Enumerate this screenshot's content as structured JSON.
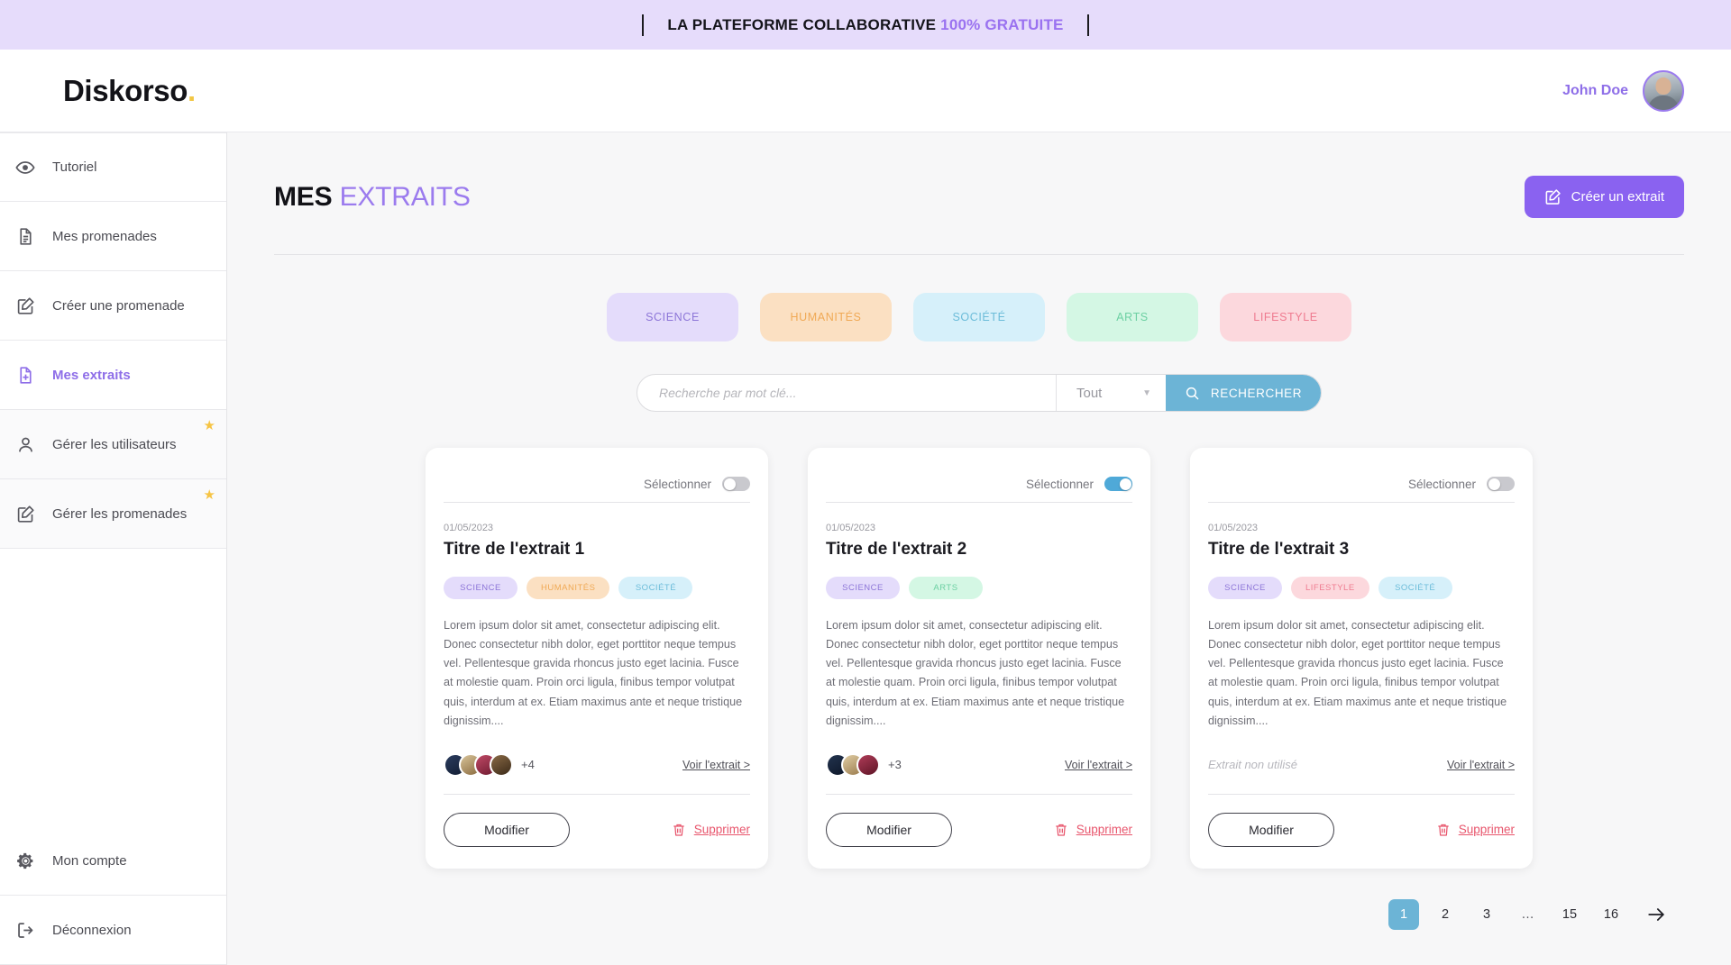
{
  "banner": {
    "text_bold": "LA PLATEFORME COLLABORATIVE",
    "text_free": "100% GRATUITE",
    "bg_color": "#e6dcfb",
    "free_color": "#9a72f0"
  },
  "header": {
    "brand": "Diskorso",
    "brand_dot": ".",
    "user_name": "John Doe",
    "avatar_icon": "user-photo"
  },
  "sidebar": {
    "items": [
      {
        "label": "Tutoriel",
        "icon": "eye-icon",
        "active": false,
        "starred": false,
        "shaded": false
      },
      {
        "label": "Mes promenades",
        "icon": "document-icon",
        "active": false,
        "starred": false,
        "shaded": false
      },
      {
        "label": "Créer une promenade",
        "icon": "pencil-square-icon",
        "active": false,
        "starred": false,
        "shaded": false
      },
      {
        "label": "Mes extraits",
        "icon": "file-plus-icon",
        "active": true,
        "starred": false,
        "shaded": false
      },
      {
        "label": "Gérer les utilisateurs",
        "icon": "user-icon",
        "active": false,
        "starred": true,
        "shaded": true
      },
      {
        "label": "Gérer les promenades",
        "icon": "pencil-square-icon",
        "active": false,
        "starred": true,
        "shaded": true
      }
    ],
    "bottom_items": [
      {
        "label": "Mon compte",
        "icon": "gear-icon"
      },
      {
        "label": "Déconnexion",
        "icon": "logout-icon"
      }
    ],
    "star_glyph": "★",
    "star_color": "#f6c444",
    "active_color": "#8e6ee8"
  },
  "page": {
    "title_bold": "MES",
    "title_accent": "EXTRAITS",
    "create_button": "Créer un extrait",
    "create_button_icon": "pencil-square-icon",
    "create_button_color": "#8a62f0"
  },
  "categories": [
    {
      "label": "SCIENCE",
      "bg": "#e4dcfb",
      "fg": "#8d76d8"
    },
    {
      "label": "HUMANITÉS",
      "bg": "#fbe0c2",
      "fg": "#f0a955"
    },
    {
      "label": "SOCIÉTÉ",
      "bg": "#d6f0fa",
      "fg": "#6cbcd9"
    },
    {
      "label": "ARTS",
      "bg": "#d4f7e4",
      "fg": "#6dd0a3"
    },
    {
      "label": "LIFESTYLE",
      "bg": "#fcd8dd",
      "fg": "#ef7b90"
    }
  ],
  "search": {
    "placeholder": "Recherche par mot clé...",
    "value": "",
    "scope_value": "Tout",
    "scope_caret": "▼",
    "button_label": "RECHERCHER",
    "button_icon": "search-icon",
    "button_color": "#6cb4d6"
  },
  "cards": [
    {
      "select_label": "Sélectionner",
      "selected": false,
      "date": "01/05/2023",
      "title": "Titre de l'extrait 1",
      "tags": [
        {
          "label": "SCIENCE",
          "bg": "#e4dcfb",
          "fg": "#8d76d8"
        },
        {
          "label": "HUMANITÉS",
          "bg": "#fbe0c2",
          "fg": "#f0a955"
        },
        {
          "label": "SOCIÉTÉ",
          "bg": "#d6f0fa",
          "fg": "#6cbcd9"
        }
      ],
      "body": "Lorem ipsum dolor sit amet, consectetur adipiscing elit. Donec consectetur nibh dolor, eget porttitor neque tempus vel. Pellentesque gravida rhoncus justo eget lacinia. Fusce at molestie quam. Proin orci ligula, finibus tempor volutpat quis, interdum at ex. Etiam maximus ante et neque tristique dignissim....",
      "has_avatars": true,
      "avatar_count": 4,
      "avatar_count_label": "+4",
      "avatar_colors": [
        "#1f2f4e",
        "#b48f63",
        "#8f2b44",
        "#5a4330"
      ],
      "unused_label": "",
      "view_link": "Voir l'extrait >",
      "edit_label": "Modifier",
      "delete_label": "Supprimer",
      "delete_icon": "trash-icon"
    },
    {
      "select_label": "Sélectionner",
      "selected": true,
      "date": "01/05/2023",
      "title": "Titre de l'extrait 2",
      "tags": [
        {
          "label": "SCIENCE",
          "bg": "#e4dcfb",
          "fg": "#8d76d8"
        },
        {
          "label": "ARTS",
          "bg": "#d4f7e4",
          "fg": "#6dd0a3"
        }
      ],
      "body": "Lorem ipsum dolor sit amet, consectetur adipiscing elit. Donec consectetur nibh dolor, eget porttitor neque tempus vel. Pellentesque gravida rhoncus justo eget lacinia. Fusce at molestie quam. Proin orci ligula, finibus tempor volutpat quis, interdum at ex. Etiam maximus ante et neque tristique dignissim....",
      "has_avatars": true,
      "avatar_count": 3,
      "avatar_count_label": "+3",
      "avatar_colors": [
        "#16263f",
        "#c2a177",
        "#7e2438"
      ],
      "unused_label": "",
      "view_link": "Voir l'extrait >",
      "edit_label": "Modifier",
      "delete_label": "Supprimer",
      "delete_icon": "trash-icon"
    },
    {
      "select_label": "Sélectionner",
      "selected": false,
      "date": "01/05/2023",
      "title": "Titre de l'extrait 3",
      "tags": [
        {
          "label": "SCIENCE",
          "bg": "#e4dcfb",
          "fg": "#8d76d8"
        },
        {
          "label": "LIFESTYLE",
          "bg": "#fcd8dd",
          "fg": "#ef7b90"
        },
        {
          "label": "SOCIÉTÉ",
          "bg": "#d6f0fa",
          "fg": "#6cbcd9"
        }
      ],
      "body": "Lorem ipsum dolor sit amet, consectetur adipiscing elit. Donec consectetur nibh dolor, eget porttitor neque tempus vel. Pellentesque gravida rhoncus justo eget lacinia. Fusce at molestie quam. Proin orci ligula, finibus tempor volutpat quis, interdum at ex. Etiam maximus ante et neque tristique dignissim....",
      "has_avatars": false,
      "avatar_count": 0,
      "avatar_count_label": "",
      "avatar_colors": [],
      "unused_label": "Extrait non utilisé",
      "view_link": "Voir l'extrait >",
      "edit_label": "Modifier",
      "delete_label": "Supprimer",
      "delete_icon": "trash-icon"
    }
  ],
  "pagination": {
    "pages": [
      "1",
      "2",
      "3",
      "…",
      "15",
      "16"
    ],
    "current": "1",
    "current_color": "#6cb4d6",
    "next_icon": "arrow-right-icon"
  }
}
